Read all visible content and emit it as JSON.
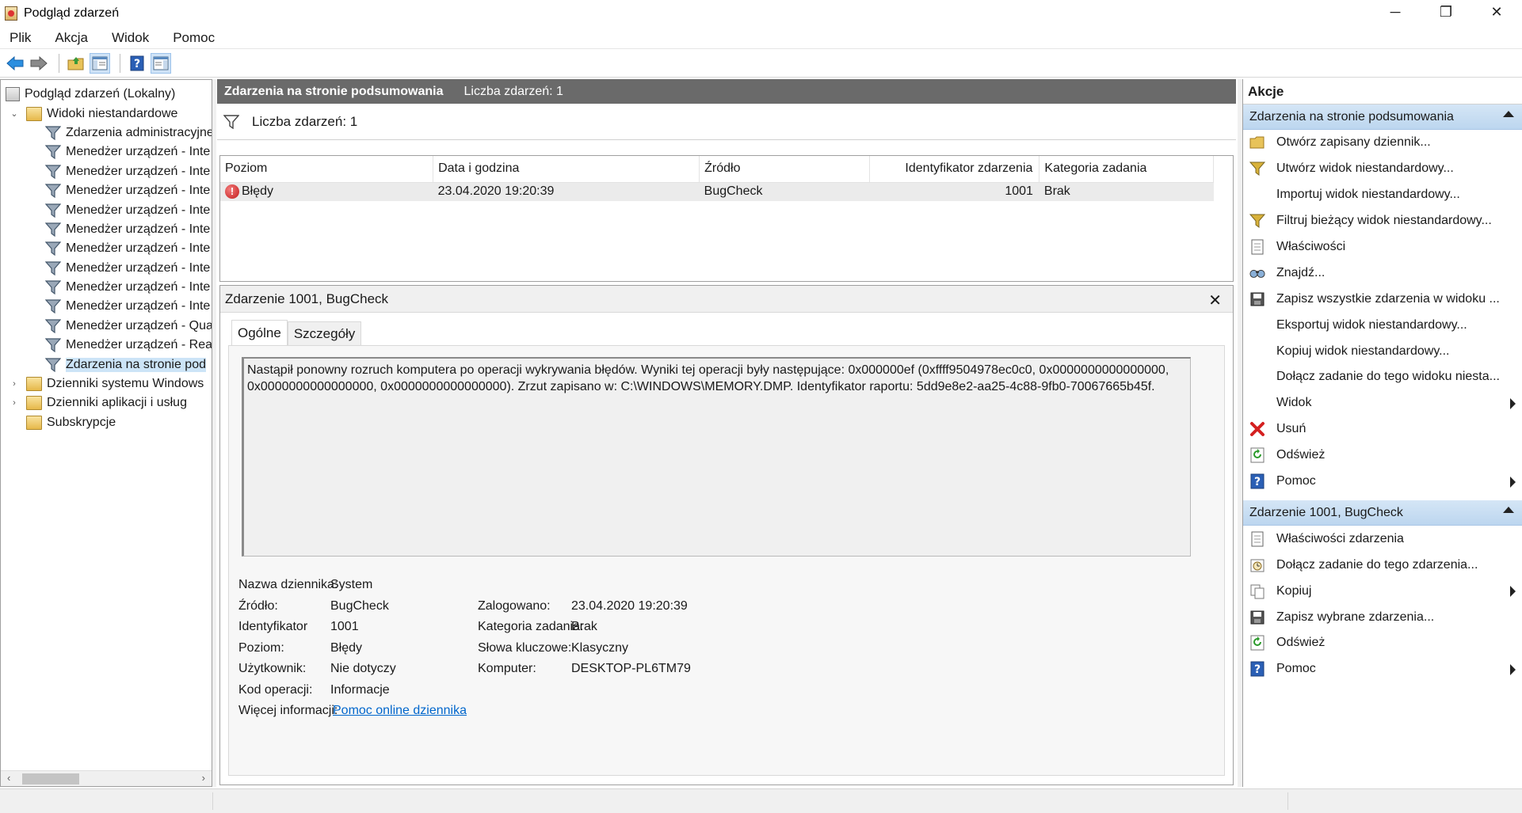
{
  "window": {
    "title": "Podgląd zdarzeń",
    "controls": {
      "minimize": "─",
      "restore": "❐",
      "close": "✕"
    }
  },
  "menu": [
    "Plik",
    "Akcja",
    "Widok",
    "Pomoc"
  ],
  "toolbar": {
    "icons": [
      "back-arrow-icon",
      "forward-arrow-icon",
      "open-folder-icon",
      "show-hide-tree-icon",
      "help-icon",
      "show-hide-action-pane-icon"
    ]
  },
  "tree": {
    "root": "Podgląd zdarzeń (Lokalny)",
    "custom_views": "Widoki niestandardowe",
    "custom_items": [
      "Zdarzenia administracyjne",
      "Menedżer urządzeń - Inte",
      "Menedżer urządzeń - Inte",
      "Menedżer urządzeń - Inte",
      "Menedżer urządzeń - Inte",
      "Menedżer urządzeń - Inte",
      "Menedżer urządzeń - Inte",
      "Menedżer urządzeń - Inte",
      "Menedżer urządzeń - Inte",
      "Menedżer urządzeń - Inte",
      "Menedżer urządzeń - Qua",
      "Menedżer urządzeń - Rea",
      "Zdarzenia na stronie pod"
    ],
    "windows_logs": "Dzienniki systemu Windows",
    "app_logs": "Dzienniki aplikacji i usług",
    "subscriptions": "Subskrypcje"
  },
  "center": {
    "header_title": "Zdarzenia na stronie podsumowania",
    "header_count": "Liczba zdarzeń: 1",
    "filter_text": "Liczba zdarzeń: 1",
    "columns": [
      "Poziom",
      "Data i godzina",
      "Źródło",
      "Identyfikator zdarzenia",
      "Kategoria zadania"
    ],
    "rows": [
      {
        "level": "Błędy",
        "datetime": "23.04.2020 19:20:39",
        "source": "BugCheck",
        "id": "1001",
        "category": "Brak"
      }
    ]
  },
  "detail": {
    "title": "Zdarzenie 1001, BugCheck",
    "close": "✕",
    "tabs": [
      "Ogólne",
      "Szczegóły"
    ],
    "description_line1": "Nastąpił ponowny rozruch komputera po operacji wykrywania błędów. Wyniki tej operacji były następujące: 0x000000ef (0xffff9504978ec0c0, 0x0000000000000000,",
    "description_line2": "0x0000000000000000, 0x0000000000000000). Zrzut zapisano w: C:\\WINDOWS\\MEMORY.DMP. Identyfikator raportu: 5dd9e8e2-aa25-4c88-9fb0-70067665b45f.",
    "log_name_label": "Nazwa dziennika:",
    "log_name": "System",
    "source_label": "Źródło:",
    "source": "BugCheck",
    "logged_label": "Zalogowano:",
    "logged": "23.04.2020 19:20:39",
    "id_label": "Identyfikator",
    "id": "1001",
    "task_label": "Kategoria zadania:",
    "task": "Brak",
    "level_label": "Poziom:",
    "level": "Błędy",
    "keywords_label": "Słowa kluczowe:",
    "keywords": "Klasyczny",
    "user_label": "Użytkownik:",
    "user": "Nie dotyczy",
    "computer_label": "Komputer:",
    "computer": "DESKTOP-PL6TM79",
    "opcode_label": "Kod operacji:",
    "opcode": "Informacje",
    "more_label": "Więcej informacji:",
    "more_link": "Pomoc online dziennika"
  },
  "actions": {
    "title": "Akcje",
    "section1": "Zdarzenia na stronie podsumowania",
    "items1": [
      "Otwórz zapisany dziennik...",
      "Utwórz widok niestandardowy...",
      "Importuj widok niestandardowy...",
      "Filtruj bieżący widok niestandardowy...",
      "Właściwości",
      "Znajdź...",
      "Zapisz wszystkie zdarzenia w widoku ...",
      "Eksportuj widok niestandardowy...",
      "Kopiuj widok niestandardowy...",
      "Dołącz zadanie do tego widoku niesta...",
      "Widok",
      "Usuń",
      "Odśwież",
      "Pomoc"
    ],
    "section2": "Zdarzenie 1001, BugCheck",
    "items2": [
      "Właściwości zdarzenia",
      "Dołącz zadanie do tego zdarzenia...",
      "Kopiuj",
      "Zapisz wybrane zdarzenia...",
      "Odśwież",
      "Pomoc"
    ]
  },
  "colors": {
    "header_bg": "#6a6a6a",
    "section_bg": "#c8dcf2",
    "selection": "#cce4f7",
    "link": "#0066cc",
    "error": "#c21b1b"
  }
}
